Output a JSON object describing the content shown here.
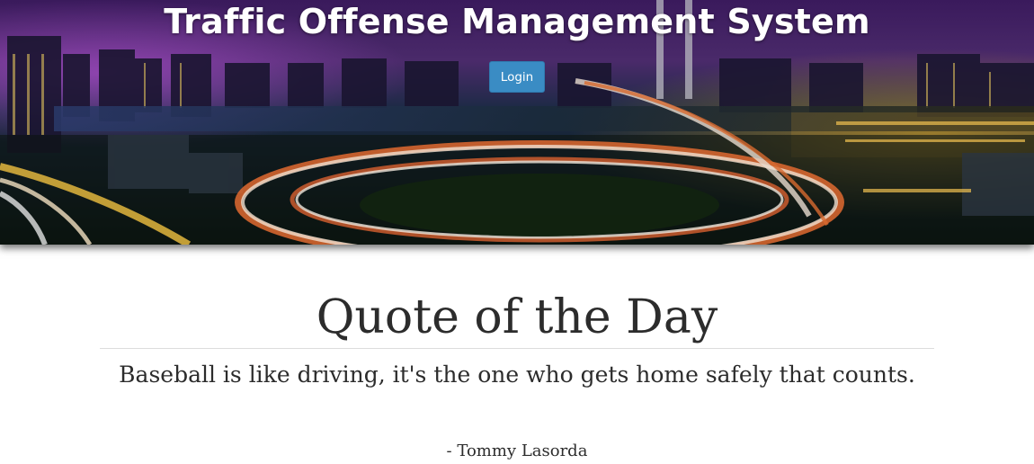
{
  "header": {
    "title": "Traffic Offense Management System",
    "login_label": "Login",
    "background_image": "city-night-highway-interchange"
  },
  "quote": {
    "heading": "Quote of the Day",
    "text": "Baseball is like driving, it's the one who gets home safely that counts.",
    "author": "- Tommy Lasorda"
  },
  "colors": {
    "login_button": "#3a8cc4",
    "text": "#2c2c2c",
    "divider": "#dcdcdc"
  }
}
